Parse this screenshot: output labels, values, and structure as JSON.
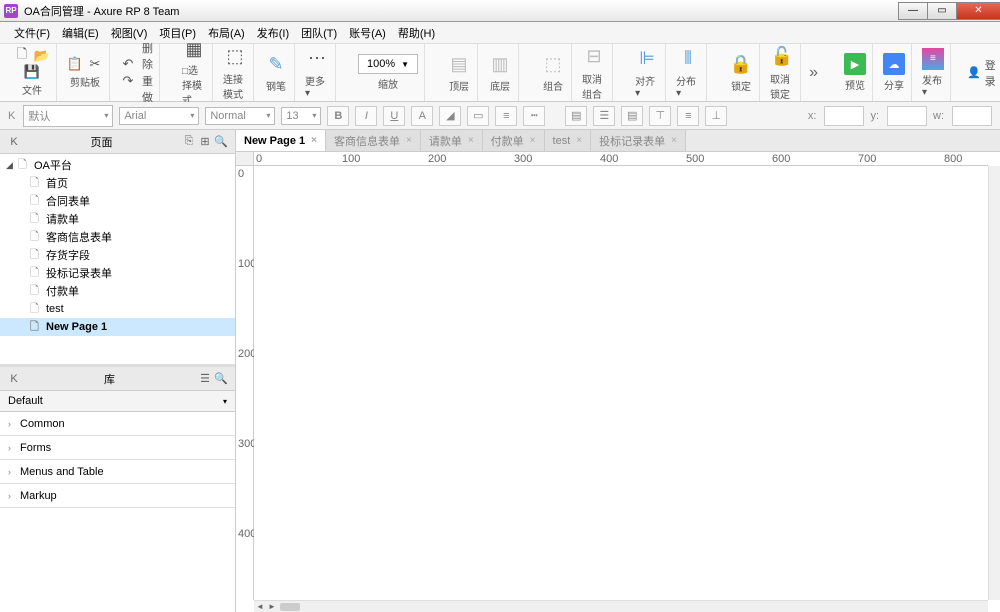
{
  "titlebar": {
    "app_icon_text": "RP",
    "title": "OA合同管理 - Axure RP 8 Team"
  },
  "menu": [
    "文件(F)",
    "编辑(E)",
    "视图(V)",
    "项目(P)",
    "布局(A)",
    "发布(I)",
    "团队(T)",
    "账号(A)",
    "帮助(H)"
  ],
  "toolbar": {
    "file_label": "文件",
    "clipboard_label": "剪贴板",
    "delete_label": "删除",
    "redo_label": "重做",
    "select_mode_label": "□选择模式",
    "connect_mode_label": "连接模式",
    "pen_label": "钢笔",
    "more_label": "更多▾",
    "zoom_value": "100%",
    "zoom_label": "缩放",
    "top_label": "顶层",
    "bottom_label": "底层",
    "group_label": "组合",
    "ungroup_label": "取消组合",
    "align_label": "对齐▾",
    "distribute_label": "分布▾",
    "lock_label": "锁定",
    "unlock_label": "取消锁定",
    "preview_label": "预览",
    "share_label": "分享",
    "publish_label": "发布▾",
    "login_label": "登录"
  },
  "format": {
    "style_placeholder": "默认",
    "font_placeholder": "Arial",
    "font_style_placeholder": "Normal",
    "font_size": "13",
    "x_label": "x:",
    "y_label": "y:",
    "w_label": "w:"
  },
  "pages_panel": {
    "title": "页面",
    "tree": [
      {
        "label": "OA平台",
        "level": 0,
        "expanded": true,
        "type": "folder",
        "children": [
          {
            "label": "首页"
          },
          {
            "label": "合同表单"
          },
          {
            "label": "请款单"
          },
          {
            "label": "客商信息表单"
          },
          {
            "label": "存货字段"
          },
          {
            "label": "投标记录表单"
          },
          {
            "label": "付款单"
          },
          {
            "label": "test"
          },
          {
            "label": "New Page 1",
            "selected": true
          }
        ]
      }
    ]
  },
  "library_panel": {
    "title": "库",
    "default_label": "Default",
    "categories": [
      "Common",
      "Forms",
      "Menus and Table",
      "Markup"
    ]
  },
  "tabs": [
    {
      "label": "New Page 1",
      "active": true
    },
    {
      "label": "客商信息表单"
    },
    {
      "label": "请款单"
    },
    {
      "label": "付款单"
    },
    {
      "label": "test"
    },
    {
      "label": "投标记录表单"
    }
  ],
  "ruler_h": [
    "0",
    "100",
    "200",
    "300",
    "400",
    "500",
    "600",
    "700",
    "800"
  ],
  "ruler_v": [
    "0",
    "100",
    "200",
    "300",
    "400"
  ]
}
